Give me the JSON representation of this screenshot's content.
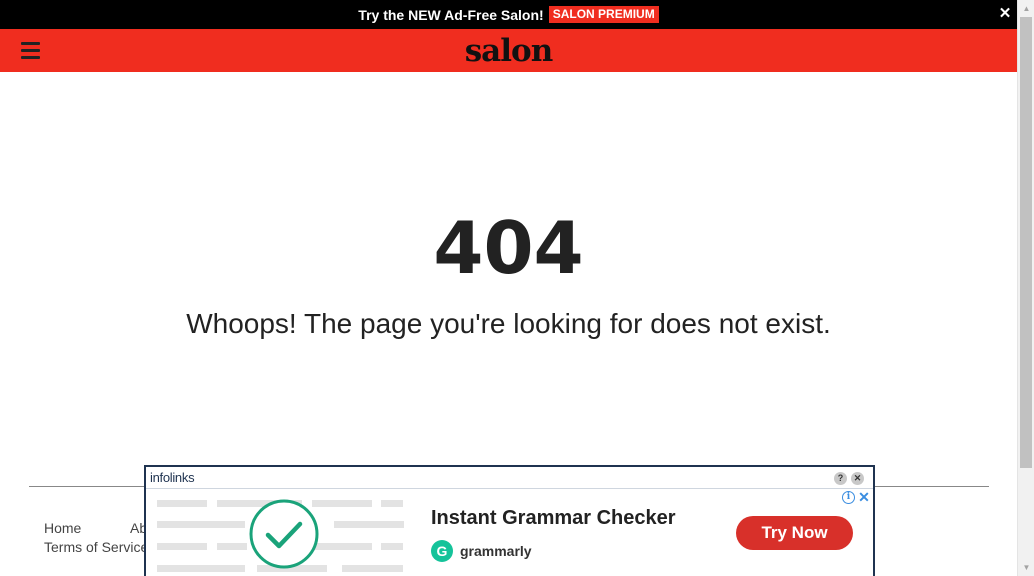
{
  "promo": {
    "text": "Try the NEW Ad-Free Salon!",
    "badge": "SALON PREMIUM",
    "close": "✕"
  },
  "header": {
    "logo": "salon",
    "menu_icon": "hamburger-menu-icon"
  },
  "error": {
    "code": "404",
    "message": "Whoops! The page you're looking for does not exist."
  },
  "footer": {
    "links": [
      "Home",
      "Ab",
      "Terms of Service"
    ]
  },
  "ad": {
    "brand": "infolinks",
    "help": "?",
    "close": "✕",
    "info": "i",
    "dismiss": "✕",
    "headline": "Instant Grammar Checker",
    "sponsor_mark": "G",
    "sponsor": "grammarly",
    "cta": "Try Now",
    "accent_color": "#15c39a",
    "cta_color": "#d8302a"
  },
  "colors": {
    "brand_red": "#f02d1f",
    "promo_bg": "#000000",
    "text_dark": "#222222"
  },
  "scrollbar": {
    "up": "▲",
    "down": "▼"
  }
}
